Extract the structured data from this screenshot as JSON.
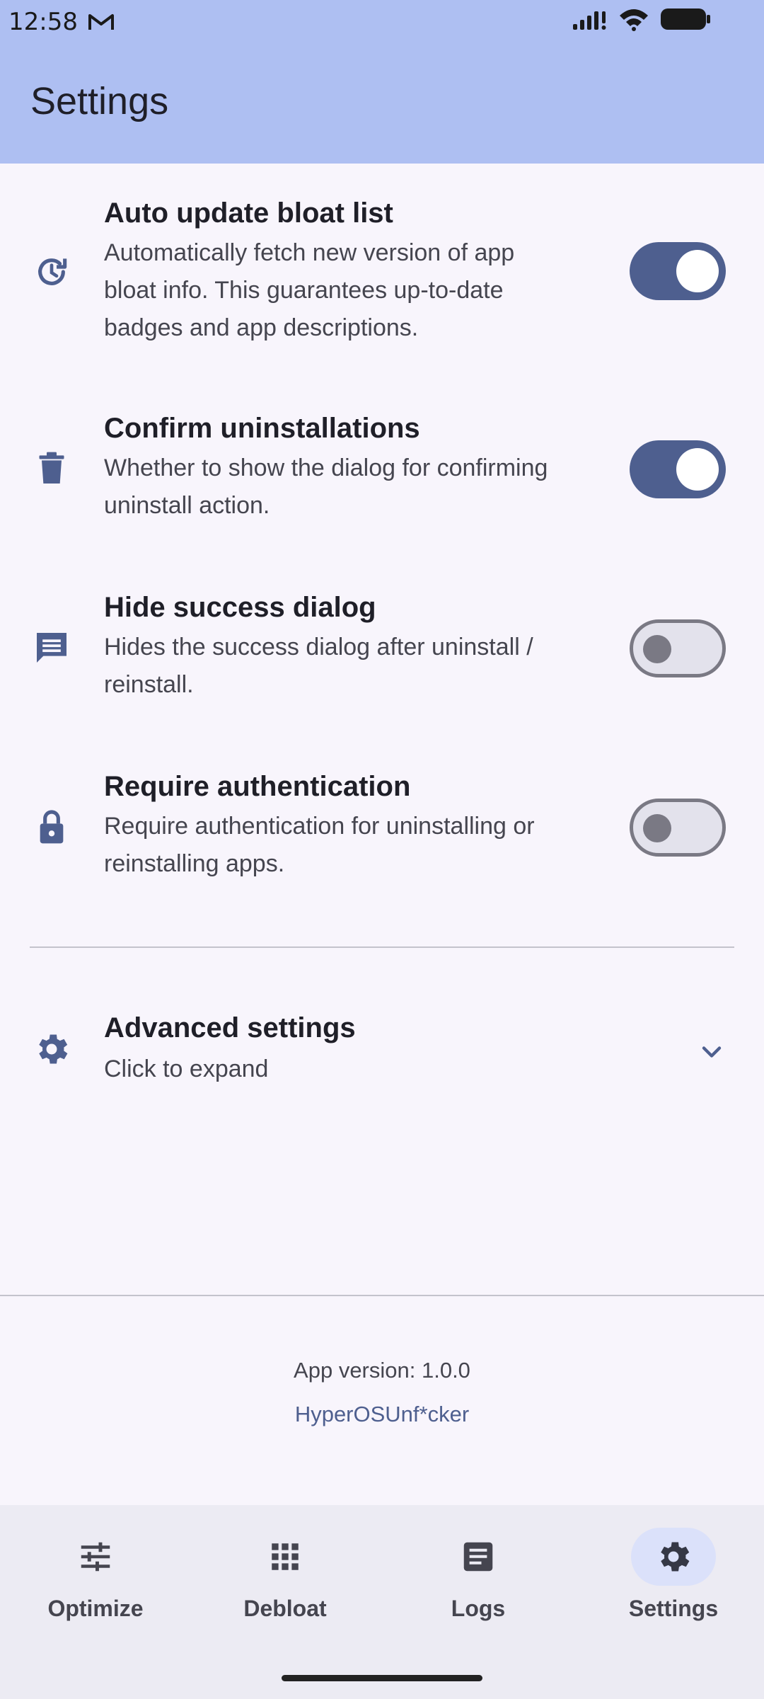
{
  "status_bar": {
    "time": "12:58"
  },
  "header": {
    "title": "Settings"
  },
  "settings": [
    {
      "title": "Auto update bloat list",
      "desc_lines": [
        "Automatically fetch new version of app",
        "bloat info. This guarantees up-to-date",
        "badges and app descriptions."
      ],
      "enabled": true,
      "icon": "history-icon"
    },
    {
      "title": "Confirm uninstallations",
      "desc_lines": [
        "Whether to show the dialog for confirming",
        "uninstall action."
      ],
      "enabled": true,
      "icon": "trash-icon"
    },
    {
      "title": "Hide success dialog",
      "desc_lines": [
        "Hides the success dialog after uninstall /",
        "reinstall."
      ],
      "enabled": false,
      "icon": "message-icon"
    },
    {
      "title": "Require authentication",
      "desc_lines": [
        "Require authentication for uninstalling or",
        "reinstalling apps."
      ],
      "enabled": false,
      "icon": "lock-icon"
    }
  ],
  "advanced": {
    "title": "Advanced settings",
    "subtitle": "Click to expand"
  },
  "footer": {
    "version": "App version: 1.0.0",
    "link": "HyperOSUnf*cker"
  },
  "nav": [
    {
      "label": "Optimize",
      "icon": "tune-icon",
      "active": false
    },
    {
      "label": "Debloat",
      "icon": "apps-grid-icon",
      "active": false
    },
    {
      "label": "Logs",
      "icon": "article-icon",
      "active": false
    },
    {
      "label": "Settings",
      "icon": "gear-icon",
      "active": true
    }
  ],
  "colors": {
    "header": "#aebff2",
    "accent": "#4e5f8f",
    "background": "#f8f5fc"
  }
}
